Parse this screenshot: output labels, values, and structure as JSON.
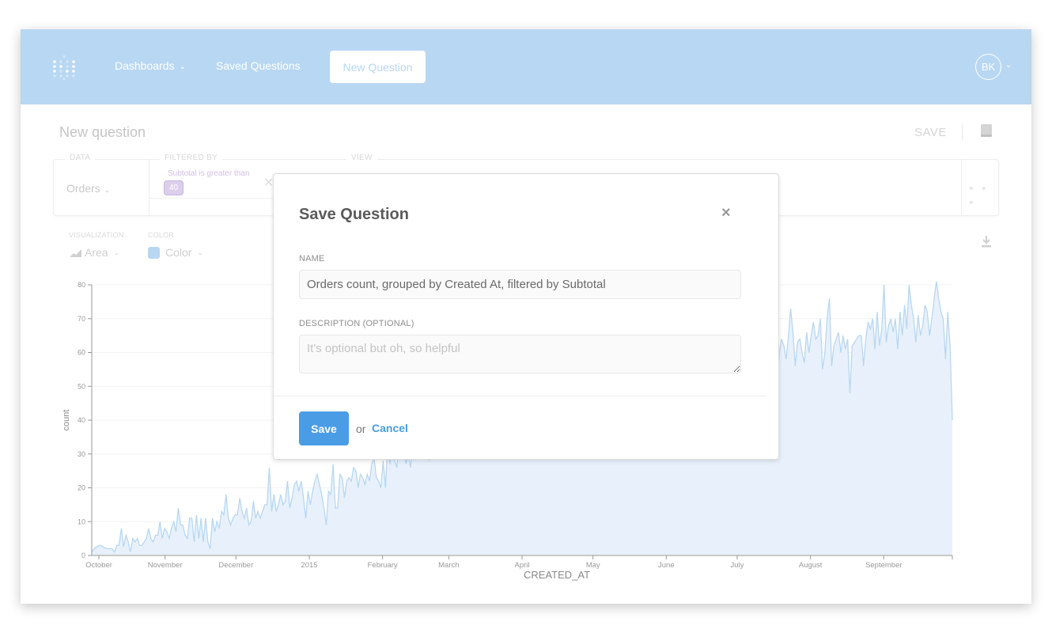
{
  "navbar": {
    "logo": "metabase-logo-icon",
    "items": [
      {
        "label": "Dashboards",
        "has_dropdown": true
      },
      {
        "label": "Saved Questions"
      }
    ],
    "new_question_label": "New Question",
    "user_initials": "BK",
    "colors": {
      "bar": "#b8d7f2",
      "text": "#ffffff"
    }
  },
  "header": {
    "title": "New question",
    "save_label": "SAVE",
    "book_icon": "book-icon"
  },
  "query_builder": {
    "data_label": "DATA",
    "data_value": "Orders",
    "filtered_by_label": "FILTERED BY",
    "filter_text": "Subtotal is greater than",
    "filter_value": "40",
    "view_label": "VIEW",
    "more_icon": "• • •"
  },
  "visualization": {
    "viz_label": "VISUALIZATION",
    "viz_value": "Area",
    "color_label": "COLOR",
    "color_value": "Color",
    "color_swatch": "#b8d7f2"
  },
  "modal": {
    "title": "Save Question",
    "close_glyph": "×",
    "name_label": "NAME",
    "name_value": "Orders count, grouped by Created At, filtered by Subtotal",
    "description_label": "DESCRIPTION (OPTIONAL)",
    "description_placeholder": "It's optional but oh, so helpful",
    "description_value": "",
    "save_label": "Save",
    "or_text": "or",
    "cancel_label": "Cancel",
    "accent": "#4a9ce4"
  },
  "chart_data": {
    "type": "area",
    "title": "",
    "xlabel": "CREATED_AT",
    "ylabel": "count",
    "ylim": [
      0,
      80
    ],
    "yticks": [
      0,
      10,
      20,
      30,
      40,
      50,
      60,
      70,
      80
    ],
    "grid": true,
    "x_start": "2014-10-01",
    "x_end": "2015-09-30",
    "xticks": [
      {
        "label": "October",
        "day": 0
      },
      {
        "label": "November",
        "day": 31
      },
      {
        "label": "December",
        "day": 61
      },
      {
        "label": "2015",
        "day": 92
      },
      {
        "label": "February",
        "day": 123
      },
      {
        "label": "March",
        "day": 151
      },
      {
        "label": "April",
        "day": 182
      },
      {
        "label": "May",
        "day": 212
      },
      {
        "label": "June",
        "day": 243
      },
      {
        "label": "July",
        "day": 273
      },
      {
        "label": "August",
        "day": 304
      },
      {
        "label": "September",
        "day": 335
      }
    ],
    "series": [
      {
        "name": "count",
        "color": "#b8d7f2",
        "fill": "#e8f1fb",
        "values": [
          1,
          2,
          2.5,
          2.8,
          3,
          2.5,
          2.2,
          2,
          2,
          2,
          1,
          3,
          3,
          8,
          2.5,
          6,
          4,
          1,
          5,
          4,
          5,
          3,
          3,
          4,
          5,
          8,
          5,
          4,
          6,
          6,
          10,
          5,
          8,
          7,
          5,
          8,
          10,
          7,
          14,
          9,
          9,
          6,
          5,
          11,
          11,
          4,
          12,
          5,
          11,
          4,
          11,
          4,
          2,
          11,
          7,
          10,
          8,
          13,
          12,
          18,
          11,
          9,
          11,
          12,
          12,
          17,
          13,
          11,
          14,
          9,
          10,
          16,
          11,
          13,
          11,
          13,
          15,
          15,
          26,
          13,
          18,
          13,
          15,
          18,
          15,
          16,
          22,
          14,
          17,
          21,
          22,
          19,
          22,
          17,
          11,
          19,
          15,
          19,
          22,
          24,
          21,
          18,
          14,
          9,
          19,
          18,
          27,
          14,
          14,
          24,
          23,
          17,
          22,
          23,
          22,
          26,
          25,
          20,
          24,
          23,
          21,
          24,
          22,
          27,
          29,
          23,
          22,
          20,
          28,
          20,
          33,
          27,
          36,
          28,
          26,
          34,
          30,
          32,
          27,
          30,
          26,
          33,
          31,
          37,
          34,
          33,
          29,
          40,
          28,
          35,
          33,
          31,
          36,
          34,
          38,
          33,
          37,
          41,
          34,
          31,
          38,
          36,
          34,
          42,
          35,
          33,
          39,
          36,
          41,
          37,
          45,
          36,
          38,
          43,
          40,
          39,
          44,
          36,
          42,
          47,
          39,
          41,
          37,
          45,
          42,
          38,
          40,
          46,
          41,
          39,
          44,
          48,
          38,
          43,
          45,
          40,
          47,
          44,
          39,
          42,
          46,
          50,
          43,
          41,
          48,
          45,
          44,
          49,
          47,
          42,
          51,
          46,
          44,
          50,
          48,
          45,
          52,
          47,
          49,
          46,
          53,
          50,
          48,
          51,
          55,
          47,
          52,
          49,
          54,
          51,
          50,
          56,
          48,
          53,
          58,
          52,
          50,
          55,
          53,
          57,
          51,
          54,
          59,
          52,
          56,
          61,
          55,
          53,
          58,
          60,
          54,
          57,
          62,
          59,
          56,
          64,
          58,
          60,
          57,
          65,
          61,
          59,
          63,
          66,
          52,
          42,
          45,
          43,
          49,
          39,
          48,
          54,
          42,
          54,
          55,
          57,
          48,
          53,
          55,
          49,
          55,
          60,
          44,
          58,
          54,
          57,
          62,
          55,
          50,
          58,
          65,
          55,
          58,
          62,
          67,
          54,
          64,
          69,
          57,
          62,
          66,
          48,
          60,
          64,
          62,
          58,
          65,
          73,
          66,
          56,
          63,
          64,
          60,
          57,
          66,
          60,
          65,
          69,
          64,
          65,
          70,
          55,
          60,
          70,
          76,
          56,
          62,
          64,
          66,
          60,
          65,
          61,
          64,
          48,
          62,
          63,
          64,
          65,
          65,
          56,
          64,
          69,
          67,
          70,
          61,
          72,
          62,
          67,
          80,
          63,
          68,
          70,
          66,
          70,
          61,
          72,
          65,
          74,
          67,
          80,
          74,
          70,
          63,
          71,
          65,
          68,
          74,
          72,
          65,
          70,
          76,
          81,
          76,
          72,
          70,
          58,
          72,
          62,
          40
        ]
      }
    ]
  }
}
